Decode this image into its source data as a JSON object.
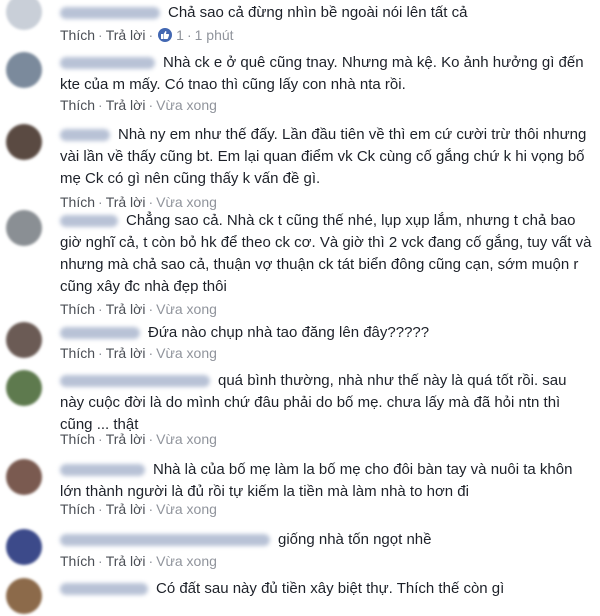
{
  "actions": {
    "like": "Thích",
    "reply": "Trả lời",
    "separator": "·"
  },
  "comments": [
    {
      "text": "Chả sao cả đừng nhìn bề ngoài nói lên tất cả",
      "reactions": "1",
      "time": "1 phút",
      "avatar_color": "#c9cfd8"
    },
    {
      "text": "Nhà ck e ở quê cũng tnay. Nhưng mà kệ. Ko ảnh hưởng gì đến kte của m mấy. Có tnao thì cũng lấy con nhà nta rồi.",
      "time": "Vừa xong",
      "avatar_color": "#7b8a9c"
    },
    {
      "text": "Nhà ny em như thế đấy. Lần đầu tiên về thì em cứ cười trừ thôi nhưng vài lần về thấy cũng bt. Em lại quan điểm vk Ck cùng cố gắng chứ k hi vọng bố mẹ Ck có gì nên cũng thấy k vấn đề gì.",
      "time": "Vừa xong",
      "avatar_color": "#5a4a42"
    },
    {
      "text": "Chẳng sao cả. Nhà ck t cũng thế nhé, lụp xụp lắm, nhưng t chả bao giờ nghĩ cả, t còn bỏ hk để theo ck cơ. Và giờ thì 2 vck đang cố gắng, tuy vất và nhưng mà chả sao cả, thuận vợ thuận ck tát biển đông cũng cạn, sớm muộn r cũng xây đc nhà đẹp thôi",
      "time": "Vừa xong",
      "avatar_color": "#8a8f94"
    },
    {
      "text": "Đứa nào chụp nhà tao đăng lên đây?????",
      "time": "Vừa xong",
      "avatar_color": "#6b5b55"
    },
    {
      "text": "quá bình thường, nhà như thế này là quá tốt rồi. sau này cuộc đời là do mình chứ đâu phải do bố mẹ. chưa lấy mà đã hỏi ntn thì cũng ... thật",
      "time": "Vừa xong",
      "avatar_color": "#5e7a4e"
    },
    {
      "text": "Nhà là của bố mẹ làm la bố mẹ cho đôi bàn tay và nuôi ta khôn lớn thành người là đủ rồi tự kiếm la tiền mà làm nhà to hơn đi",
      "time": "Vừa xong",
      "avatar_color": "#7a5a50"
    },
    {
      "text": "giống nhà tốn ngọt nhề",
      "time": "Vừa xong",
      "avatar_color": "#3c4a8a"
    },
    {
      "text": "Có đất sau này đủ tiền xây biệt thự. Thích thế còn gì",
      "avatar_color": "#8c6a4a"
    }
  ]
}
